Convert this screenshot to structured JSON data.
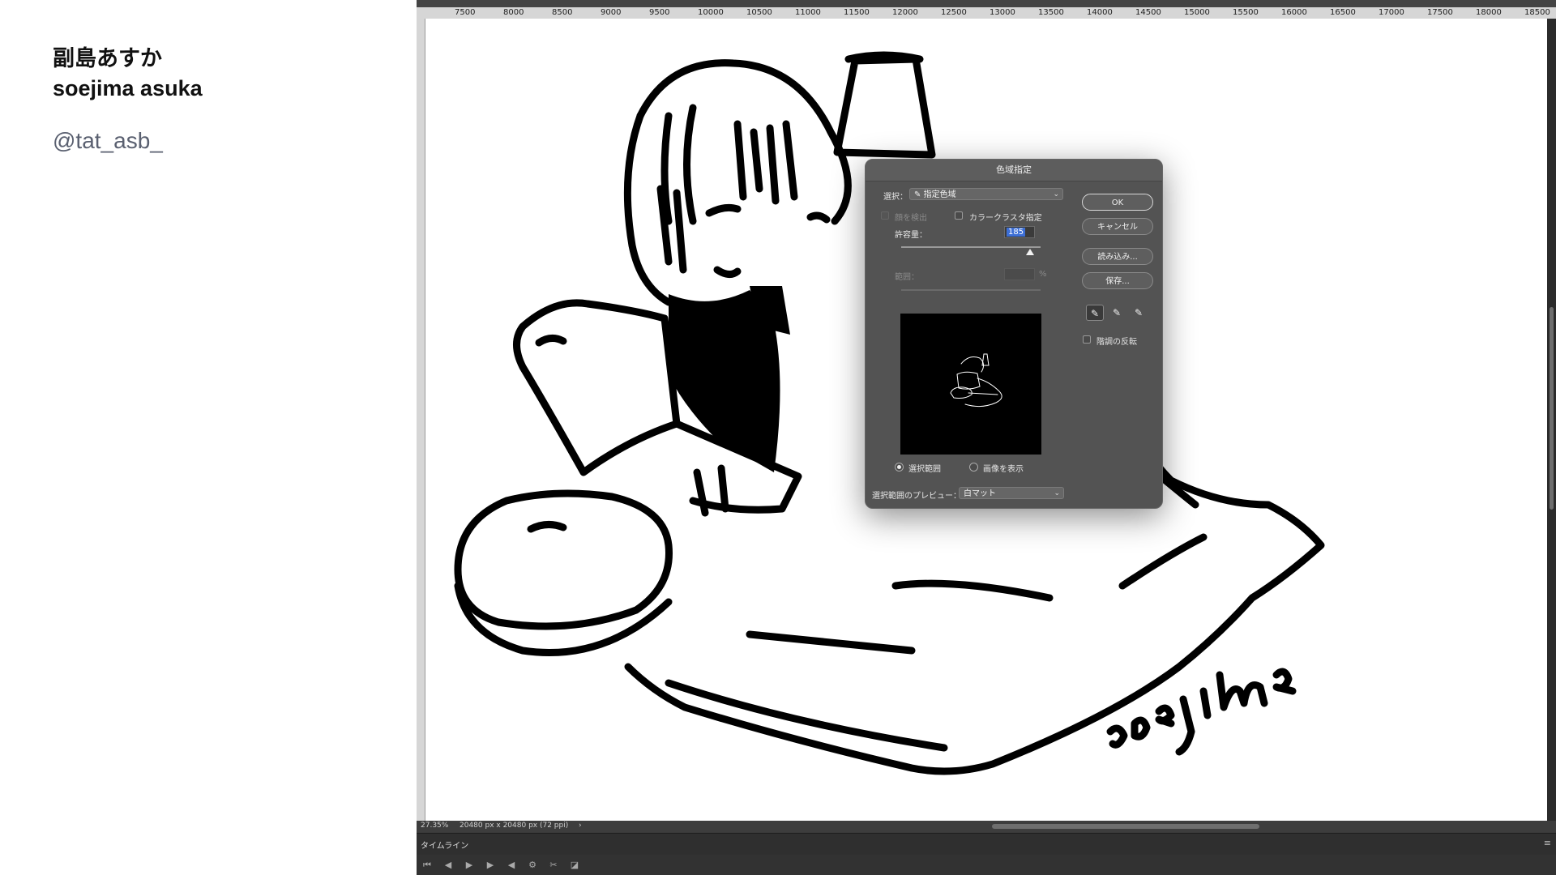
{
  "caption": {
    "name_ja": "副島あすか",
    "name_en": "soejima asuka",
    "handle": "@tat_asb_"
  },
  "ruler": {
    "labels": [
      "7500",
      "8000",
      "8500",
      "9000",
      "9500",
      "10000",
      "10500",
      "11000",
      "11500",
      "12000",
      "12500",
      "13000",
      "13500",
      "14000",
      "14500",
      "15000",
      "15500",
      "16000",
      "16500",
      "17000",
      "17500",
      "18000",
      "18500"
    ]
  },
  "artwork": {
    "signature": "soejima"
  },
  "status_bar": {
    "zoom": "27.35%",
    "doc_info": "20480 px x 20480 px (72 ppi)",
    "arrow": "›"
  },
  "timeline": {
    "label": "タイムライン",
    "menu_icon": "≡"
  },
  "controls": [
    "⏮",
    "◀",
    "▶",
    "▶",
    "◀",
    "⚙",
    "✂",
    "◪"
  ],
  "dialog": {
    "title": "色域指定",
    "select_label": "選択：",
    "select_value": "指定色域",
    "select_icon": "eyedropper-icon",
    "detect_faces": "顔を検出",
    "color_clusters": "カラークラスタ指定",
    "fuzziness_label": "許容量：",
    "fuzziness_value": "185",
    "fuzziness_fraction": 0.925,
    "range_label": "範囲：",
    "range_unit": "%",
    "radio_selection": "選択範囲",
    "radio_image": "画像を表示",
    "preview_label": "選択範囲のプレビュー：",
    "preview_value": "白マット",
    "ok": "OK",
    "cancel": "キャンセル",
    "load": "読み込み...",
    "save": "保存...",
    "invert": "階調の反転"
  },
  "colors": {
    "ps_dark": "#3a3a3a",
    "dialog_bg": "#535353",
    "highlight": "#3d6fd6",
    "handle_gray": "#5a6070"
  }
}
